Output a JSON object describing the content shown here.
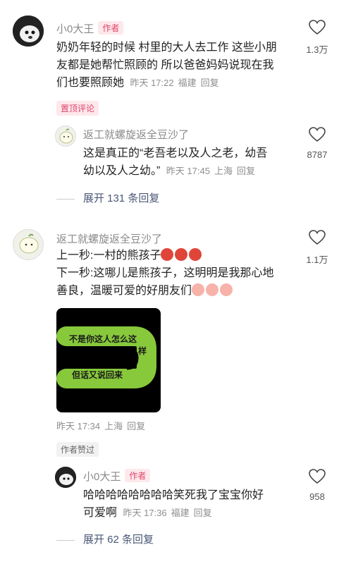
{
  "comments": [
    {
      "name": "小0大王",
      "author_tag": "作者",
      "text": "奶奶年轻的时候 村里的大人去工作 这些小朋友都是她帮忙照顾的 所以爸爸妈妈说现在我们也要照顾她",
      "lines": [
        "奶奶年轻的时候 村里的大人去工作 这些小朋",
        "友都是她帮忙照顾的 所以爸爸妈妈说现在我",
        "们也要照顾她"
      ],
      "time": "昨天 17:22",
      "location": "福建",
      "reply": "回复",
      "likes": "1.3万",
      "pin_label": "置顶评论"
    },
    {
      "name": "返工就螺旋返全豆沙了",
      "lines": [
        "这是真正的“老吾老以及人之老，幼吾",
        "幼以及人之幼。”"
      ],
      "time": "昨天 17:45",
      "location": "上海",
      "reply": "回复",
      "likes": "8787"
    },
    {
      "name": "返工就螺旋返全豆沙了",
      "line1": "上一秒:一村的熊孩子",
      "line2": "下一秒:这哪儿是熊孩子，这明明是我那心地",
      "line3": "善良，温暖可爱的好朋友们",
      "sticker_top": "不是你这人怎么这",
      "sticker_side": "样",
      "sticker_bottom": "但话又说回来",
      "time": "昨天 17:34",
      "location": "上海",
      "reply": "回复",
      "likes": "1.1万",
      "author_liked": "作者赞过"
    },
    {
      "name": "小0大王",
      "author_tag": "作者",
      "lines": [
        "哈哈哈哈哈哈哈哈笑死我了宝宝你好",
        "可爱啊"
      ],
      "time": "昨天 17:36",
      "location": "福建",
      "reply": "回复",
      "likes": "958"
    }
  ],
  "expand_1": "展开 131 条回复",
  "expand_2": "展开 62 条回复",
  "colors": {
    "accent_pink": "#e0456a",
    "link_blue": "#4a5877"
  },
  "icons": [
    "heart-icon",
    "devil-emoji-icon",
    "pig-emoji-icon"
  ]
}
